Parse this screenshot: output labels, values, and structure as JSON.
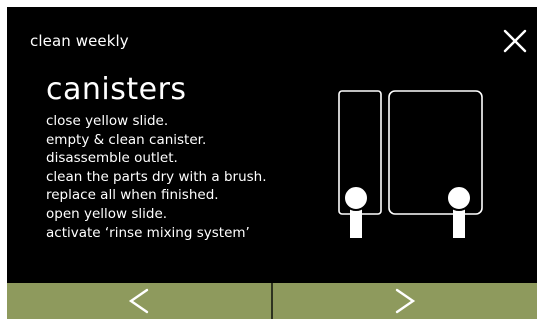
{
  "header": {
    "title": "clean weekly",
    "close_icon": "close-icon"
  },
  "content": {
    "heading": "canisters",
    "steps": [
      "close yellow slide.",
      "empty & clean canister.",
      "disassemble outlet.",
      "clean the parts dry with a brush.",
      "replace all when finished.",
      "open yellow slide.",
      "activate ‘rinse mixing system’"
    ],
    "illustration_icon": "canisters-illustration"
  },
  "navigation": {
    "previous_icon": "chevron-left-icon",
    "next_icon": "chevron-right-icon"
  },
  "colors": {
    "screen_background": "#000000",
    "text": "#ffffff",
    "nav_button": "#8e9a5d"
  }
}
